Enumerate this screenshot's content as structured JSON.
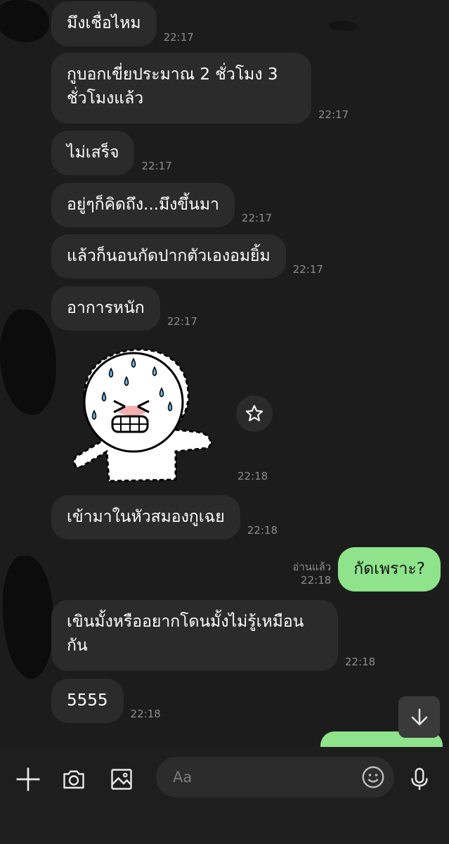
{
  "messages": [
    {
      "text": "มึงเชื่อไหม",
      "time": "22:17"
    },
    {
      "text": "กูบอกเขี่ยประมาณ 2 ชั่วโมง 3 ชั่วโมงแล้ว",
      "time": "22:17"
    },
    {
      "text": "ไม่เสร็จ",
      "time": "22:17"
    },
    {
      "text": "อยู่ๆก็คิดถึง...มึงขึ้นมา",
      "time": "22:17"
    },
    {
      "text": "แล้วก็นอนกัดปากตัวเองอมยิ้ม",
      "time": "22:17"
    },
    {
      "text": "อาการหนัก",
      "time": "22:17"
    },
    {
      "text": "เข้ามาในหัวสมองกูเฉย",
      "time": "22:18"
    },
    {
      "text": "เขินมั้งหรืออยากโดนมั้งไม่รู้เหมือนกัน",
      "time": "22:18"
    },
    {
      "text": "5555",
      "time": "22:18"
    }
  ],
  "sticker": {
    "time": "22:18",
    "icon": "crying-sticker"
  },
  "outgoing": [
    {
      "text": "กัดเพราะ?",
      "read": "อ่านแล้ว",
      "time": "22:18"
    }
  ],
  "input": {
    "placeholder": "Aa"
  },
  "icons": {
    "add": "plus-icon",
    "camera": "camera-icon",
    "gallery": "image-icon",
    "emoji": "emoji-icon",
    "mic": "microphone-icon",
    "favorite": "star-icon",
    "scroll": "arrow-down-icon"
  },
  "colors": {
    "background": "#1c1c1c",
    "incoming_bubble": "#2b2b2b",
    "outgoing_bubble": "#8fe38b"
  }
}
